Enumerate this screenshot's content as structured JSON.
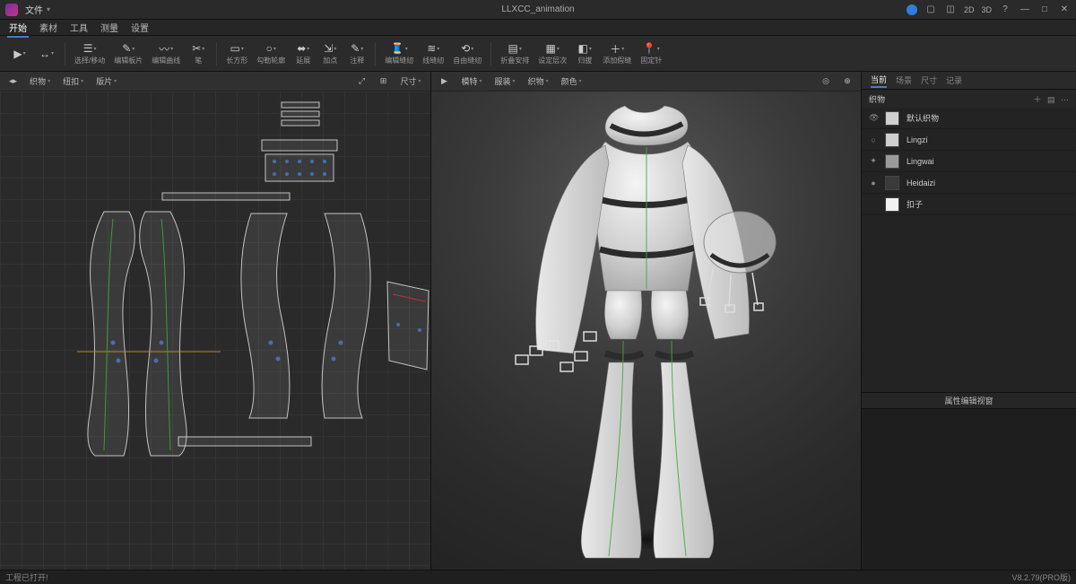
{
  "title": "LLXCC_animation",
  "file_menu": "文件",
  "window_modes": [
    "2D",
    "3D"
  ],
  "menubar": [
    "开始",
    "素材",
    "工具",
    "测量",
    "设置"
  ],
  "menubar_active": 0,
  "ribbon": [
    {
      "icon": "▶",
      "label": ""
    },
    {
      "icon": "↔",
      "label": ""
    },
    {
      "sep": true
    },
    {
      "icon": "☰",
      "label": "选择/移动"
    },
    {
      "icon": "✎",
      "label": "编辑板片"
    },
    {
      "icon": "〰",
      "label": "编辑曲线"
    },
    {
      "icon": "✂",
      "label": "笔"
    },
    {
      "sep": true
    },
    {
      "icon": "▭",
      "label": "长方形"
    },
    {
      "icon": "○",
      "label": "勾勒轮廓"
    },
    {
      "icon": "⬌",
      "label": "延展"
    },
    {
      "icon": "⇲",
      "label": "加点"
    },
    {
      "icon": "✎",
      "label": "注释"
    },
    {
      "sep": true
    },
    {
      "icon": "🧵",
      "label": "编辑缝纫"
    },
    {
      "icon": "≋",
      "label": "线缝纫"
    },
    {
      "icon": "⟲",
      "label": "自由缝纫"
    },
    {
      "sep": true
    },
    {
      "icon": "▤",
      "label": "折叠安排"
    },
    {
      "icon": "▦",
      "label": "设定层次"
    },
    {
      "icon": "◧",
      "label": "归拔"
    },
    {
      "icon": "＋",
      "label": "添加假缝"
    },
    {
      "icon": "📍",
      "label": "固定针"
    }
  ],
  "panel2d_tabs": [
    "织物",
    "纽扣",
    "版片"
  ],
  "panel3d_tabs": [
    "模特",
    "服装",
    "织物",
    "颜色"
  ],
  "sidebar": {
    "tabs": [
      "当前",
      "场景",
      "尺寸",
      "记录"
    ],
    "active_tab": 0,
    "list_title": "织物",
    "list_actions": [
      "＋",
      "▤",
      "⋯"
    ],
    "layers": [
      {
        "name": "默认织物",
        "color": "#d0d0d0",
        "vis": "👁"
      },
      {
        "name": "Lingzi",
        "color": "#cfcfcf",
        "vis": "○"
      },
      {
        "name": "Lingwai",
        "color": "#9a9a9a",
        "vis": "✦"
      },
      {
        "name": "Heidaizi",
        "color": "#3a3a3a",
        "vis": "●"
      },
      {
        "name": "扣子",
        "color": "#f2f2f2",
        "vis": ""
      }
    ],
    "prop_title": "属性编辑视窗"
  },
  "panel2d_head_right": [
    "⤢",
    "⊞",
    "尺寸"
  ],
  "panel3d_head_right": [
    "◎",
    "⊕"
  ],
  "panel3d_head_left_icon": "▶",
  "status_left": "工程已打开!",
  "status_right": "V8.2.79(PRO版)"
}
